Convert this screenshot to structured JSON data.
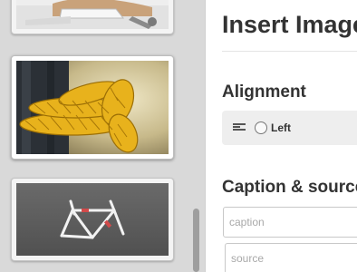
{
  "library": {
    "thumbnails": [
      {
        "name": "desk-photo",
        "selected": false
      },
      {
        "name": "yellow-rope-photo",
        "selected": true
      },
      {
        "name": "bike-frame-photo",
        "selected": false
      }
    ]
  },
  "panel": {
    "title": "Insert Image",
    "alignment": {
      "heading": "Alignment",
      "option_label": "Left"
    },
    "caption_section": {
      "heading": "Caption & source",
      "caption_placeholder": "caption",
      "source_placeholder": "source"
    }
  }
}
